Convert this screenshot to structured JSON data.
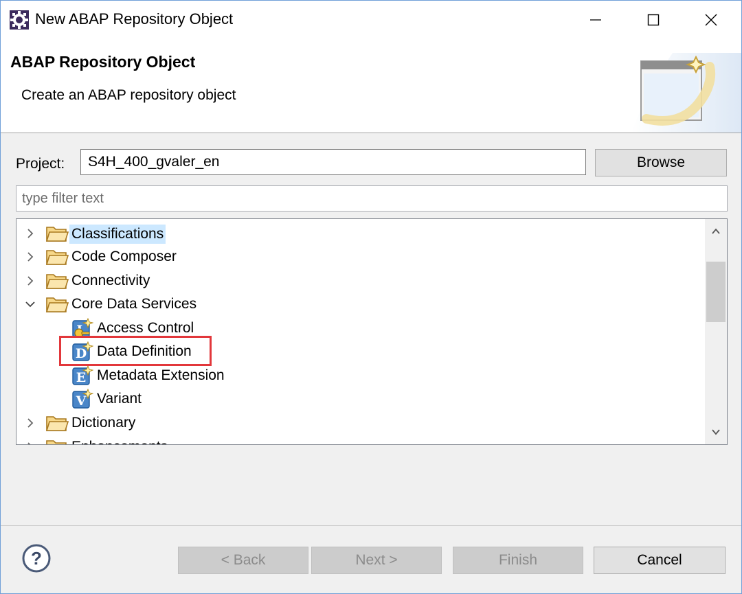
{
  "window": {
    "title": "New ABAP Repository Object",
    "icon": "eclipse-gear-icon",
    "controls": [
      "minimize-icon",
      "maximize-icon",
      "close-icon"
    ]
  },
  "banner": {
    "title": "ABAP Repository Object",
    "description": "Create an ABAP repository object",
    "graphic": "wizard-banner-icon"
  },
  "project": {
    "label": "Project:",
    "value": "S4H_400_gvaler_en",
    "browse_label": "Browse"
  },
  "filter": {
    "placeholder": "type filter text",
    "value": ""
  },
  "tree": {
    "items": [
      {
        "label": "Classifications",
        "type": "folder",
        "expanded": false,
        "selected": true,
        "level": 0
      },
      {
        "label": "Code Composer",
        "type": "folder",
        "expanded": false,
        "selected": false,
        "level": 0
      },
      {
        "label": "Connectivity",
        "type": "folder",
        "expanded": false,
        "selected": false,
        "level": 0
      },
      {
        "label": "Core Data Services",
        "type": "folder",
        "expanded": true,
        "selected": false,
        "level": 0
      },
      {
        "label": "Access Control",
        "type": "object",
        "icon_letter": "L",
        "level": 1
      },
      {
        "label": "Data Definition",
        "type": "object",
        "icon_letter": "D",
        "level": 1,
        "highlighted": true
      },
      {
        "label": "Metadata Extension",
        "type": "object",
        "icon_letter": "E",
        "level": 1
      },
      {
        "label": "Variant",
        "type": "object",
        "icon_letter": "V",
        "level": 1
      },
      {
        "label": "Dictionary",
        "type": "folder",
        "expanded": false,
        "selected": false,
        "level": 0
      },
      {
        "label": "Enhancements",
        "type": "folder",
        "expanded": false,
        "selected": false,
        "level": 0,
        "partially_visible": true
      }
    ],
    "highlight_color": "#e2373b",
    "selection_color": "#cce8ff"
  },
  "footer": {
    "help_icon": "help-question-icon",
    "back_label": "< Back",
    "next_label": "Next >",
    "finish_label": "Finish",
    "cancel_label": "Cancel",
    "back_enabled": false,
    "next_enabled": false,
    "finish_enabled": false
  }
}
